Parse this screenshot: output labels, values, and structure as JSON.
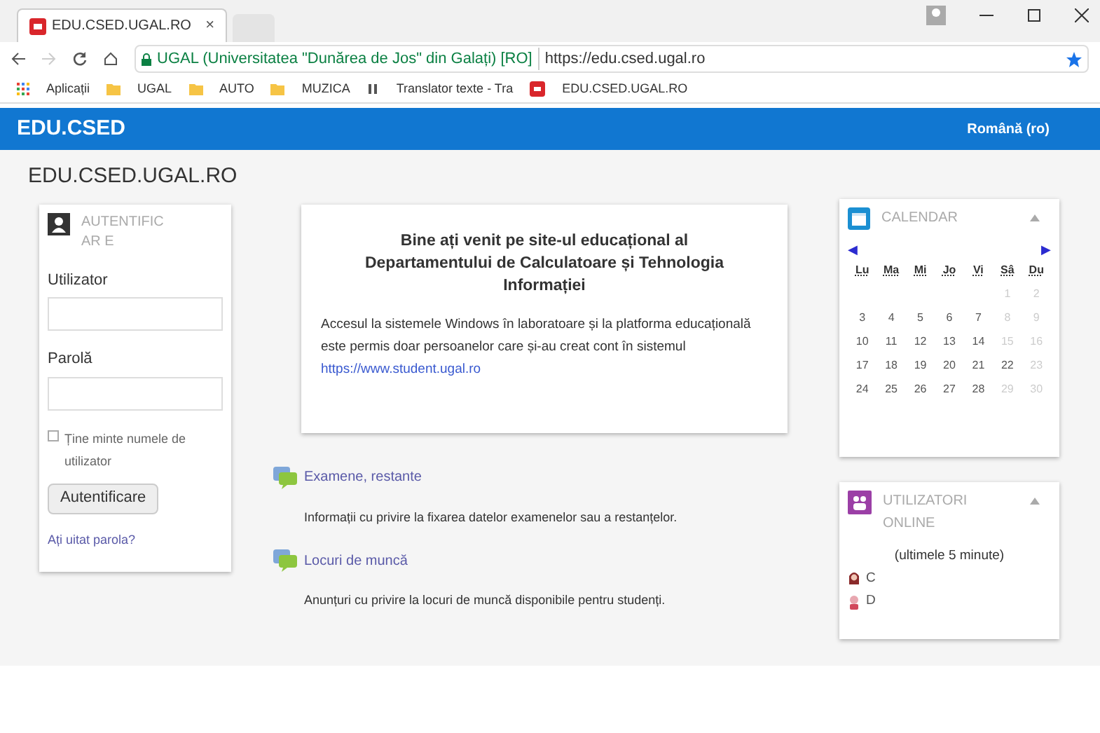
{
  "browser": {
    "tab_title": "EDU.CSED.UGAL.RO",
    "tab_close": "×",
    "address_site": "UGAL (Universitatea \"Dunărea de Jos\" din Galați) [RO]",
    "address_url": "https://edu.csed.ugal.ro",
    "bookmarks": [
      {
        "kind": "apps",
        "label": "Aplicații"
      },
      {
        "kind": "folder",
        "label": "UGAL"
      },
      {
        "kind": "folder",
        "label": "AUTO"
      },
      {
        "kind": "folder",
        "label": "MUZICA"
      },
      {
        "kind": "translate",
        "label": "Translator texte - Tra"
      },
      {
        "kind": "site",
        "label": "EDU.CSED.UGAL.RO"
      }
    ]
  },
  "navbar": {
    "brand": "EDU.CSED",
    "language": "Română (ro)"
  },
  "site_title": "EDU.CSED.UGAL.RO",
  "login": {
    "title": "AUTENTIFICAR E",
    "username_label": "Utilizator",
    "password_label": "Parolă",
    "remember": {
      "label": "Ține minte numele de utilizator",
      "checked": false
    },
    "button": "Autentificare",
    "forgot": "Ați uitat parola?"
  },
  "welcome": {
    "heading": "Bine ați venit pe site-ul educațional al Departamentului de Calculatoare și Tehnologia Informației",
    "body": "Accesul la sistemele Windows în laboratoare și la platforma educațională este permis doar persoanelor care și-au creat cont în sistemul",
    "link": "https://www.student.ugal.ro"
  },
  "forums": [
    {
      "title": "Examene, restante",
      "description": "Informații cu privire la fixarea datelor examenelor sau a restanțelor."
    },
    {
      "title": "Locuri de muncă",
      "description": "Anunțuri cu privire la locuri de muncă disponibile pentru studenți."
    }
  ],
  "calendar": {
    "title": "CALENDAR",
    "prev": "◀",
    "next": "▶",
    "weekdays": [
      "Lu",
      "Ma",
      "Mi",
      "Jo",
      "Vi",
      "Sâ",
      "Du"
    ],
    "weeks": [
      [
        {
          "day": "1",
          "dimmed": true
        },
        {
          "day": "2",
          "dimmed": true
        }
      ],
      [
        {
          "day": "3",
          "dimmed": false
        },
        {
          "day": "4",
          "dimmed": false
        },
        {
          "day": "5",
          "dimmed": false
        },
        {
          "day": "6",
          "dimmed": false
        },
        {
          "day": "7",
          "dimmed": false
        },
        {
          "day": "8",
          "dimmed": true
        },
        {
          "day": "9",
          "dimmed": true
        }
      ],
      [
        {
          "day": "10",
          "dimmed": false
        },
        {
          "day": "11",
          "dimmed": false
        },
        {
          "day": "12",
          "dimmed": false
        },
        {
          "day": "13",
          "dimmed": false
        },
        {
          "day": "14",
          "dimmed": false
        },
        {
          "day": "15",
          "dimmed": true
        },
        {
          "day": "16",
          "dimmed": true
        }
      ],
      [
        {
          "day": "17",
          "dimmed": false
        },
        {
          "day": "18",
          "dimmed": false
        },
        {
          "day": "19",
          "dimmed": false
        },
        {
          "day": "20",
          "dimmed": false
        },
        {
          "day": "21",
          "dimmed": false
        },
        {
          "day": "22",
          "dimmed": false
        },
        {
          "day": "23",
          "dimmed": true
        }
      ],
      [
        {
          "day": "24",
          "dimmed": false
        },
        {
          "day": "25",
          "dimmed": false
        },
        {
          "day": "26",
          "dimmed": false
        },
        {
          "day": "27",
          "dimmed": false
        },
        {
          "day": "28",
          "dimmed": false
        },
        {
          "day": "29",
          "dimmed": true
        },
        {
          "day": "30",
          "dimmed": true
        }
      ]
    ]
  },
  "online": {
    "title": "UTILIZATORI ONLINE",
    "period": "(ultimele 5 minute)",
    "users": [
      {
        "name": "C",
        "kind": "female"
      },
      {
        "name": "D",
        "kind": "male"
      }
    ]
  }
}
